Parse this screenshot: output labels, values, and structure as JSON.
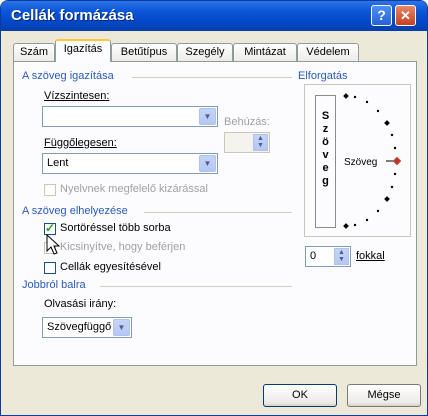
{
  "window": {
    "title": "Cellák formázása",
    "help_label": "?",
    "close_label": "✕"
  },
  "tabs": [
    {
      "label": "Szám"
    },
    {
      "label": "Igazítás",
      "active": true
    },
    {
      "label": "Betűtípus"
    },
    {
      "label": "Szegély"
    },
    {
      "label": "Mintázat"
    },
    {
      "label": "Védelem"
    }
  ],
  "alignment": {
    "group_title": "A szöveg igazítása",
    "horizontal_label": "Vízszintesen:",
    "horizontal_value": "",
    "vertical_label": "Függőlegesen:",
    "vertical_value": "Lent",
    "indent_label": "Behúzás:",
    "indent_value": "",
    "justify_distributed_label": "Nyelvnek megfelelő kizárással",
    "justify_distributed_checked": false
  },
  "text_control": {
    "group_title": "A szöveg elhelyezése",
    "wrap_text_label": "Sortöréssel több sorba",
    "wrap_text_checked": true,
    "shrink_label": "Kicsinyítve, hogy beférjen",
    "shrink_checked": false,
    "merge_label": "Cellák egyesítésével",
    "merge_checked": false
  },
  "rtl": {
    "group_title": "Jobbról balra",
    "direction_label": "Olvasási irány:",
    "direction_value": "Szövegfüggő"
  },
  "orientation": {
    "group_title": "Elforgatás",
    "vertical_text": [
      "S",
      "z",
      "ö",
      "v",
      "e",
      "g"
    ],
    "dial_text": "Szöveg",
    "degrees_value": "0",
    "degrees_label": "fokkal"
  },
  "buttons": {
    "ok": "OK",
    "cancel": "Mégse"
  },
  "icons": {
    "spinner": "spinner-icon",
    "dropdown": "chevron-down-icon",
    "pointer": "mouse-pointer-icon"
  },
  "colors": {
    "titlebar": "#0a55d8",
    "group_title": "#2a5ab8",
    "active_tab_accent": "#ffc83c",
    "dial_marker": "#c0392b"
  }
}
